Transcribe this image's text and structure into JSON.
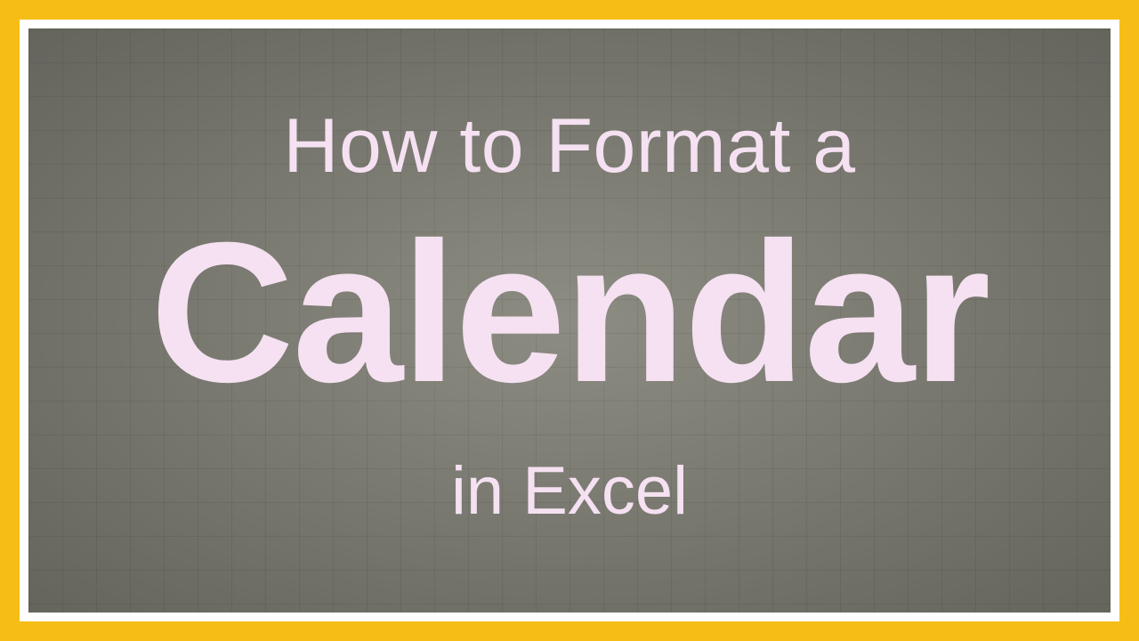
{
  "title": {
    "line1": "How to Format a",
    "line2": "Calendar",
    "line3": "in Excel"
  },
  "colors": {
    "frame": "#f6bd17",
    "inner_frame": "#ffffff",
    "board": "#86867c",
    "text": "#f5e1f1"
  }
}
